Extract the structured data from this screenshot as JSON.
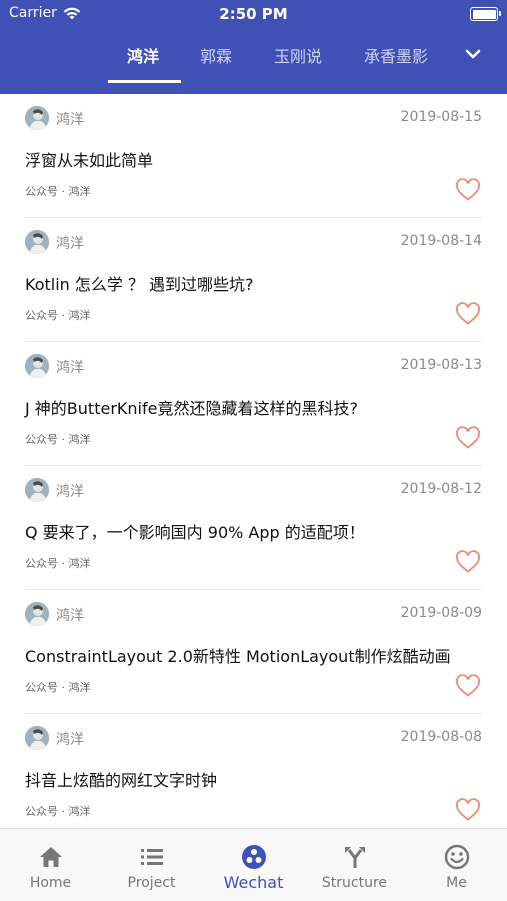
{
  "status_bar": {
    "carrier": "Carrier",
    "time": "2:50 PM"
  },
  "tabs": {
    "items": [
      {
        "label": "鸿洋",
        "active": true
      },
      {
        "label": "郭霖",
        "active": false
      },
      {
        "label": "玉刚说",
        "active": false
      },
      {
        "label": "承香墨影",
        "active": false
      }
    ],
    "more_icon": "chevron-down-icon"
  },
  "articles": [
    {
      "author": "鸿洋",
      "date": "2019-08-15",
      "title": "浮窗从未如此简单",
      "meta": "公众号 · 鸿洋"
    },
    {
      "author": "鸿洋",
      "date": "2019-08-14",
      "title": "Kotlin 怎么学 ？ 遇到过哪些坑?",
      "meta": "公众号 · 鸿洋"
    },
    {
      "author": "鸿洋",
      "date": "2019-08-13",
      "title": "J 神的ButterKnife竟然还隐藏着这样的黑科技?",
      "meta": "公众号 · 鸿洋"
    },
    {
      "author": "鸿洋",
      "date": "2019-08-12",
      "title": "Q 要来了，一个影响国内 90% App 的适配项！",
      "meta": "公众号 · 鸿洋"
    },
    {
      "author": "鸿洋",
      "date": "2019-08-09",
      "title": "ConstraintLayout 2.0新特性 MotionLayout制作炫酷动画",
      "meta": "公众号 · 鸿洋"
    },
    {
      "author": "鸿洋",
      "date": "2019-08-08",
      "title": "抖音上炫酷的网红文字时钟",
      "meta": "公众号 · 鸿洋"
    }
  ],
  "bottom_nav": {
    "items": [
      {
        "label": "Home",
        "icon": "home-icon"
      },
      {
        "label": "Project",
        "icon": "list-icon"
      },
      {
        "label": "Wechat",
        "icon": "wechat-icon",
        "active": true
      },
      {
        "label": "Structure",
        "icon": "structure-icon"
      },
      {
        "label": "Me",
        "icon": "smiley-icon"
      }
    ]
  },
  "colors": {
    "primary": "#3f51b5",
    "heart": "#f08a74",
    "inactive": "#767676"
  }
}
